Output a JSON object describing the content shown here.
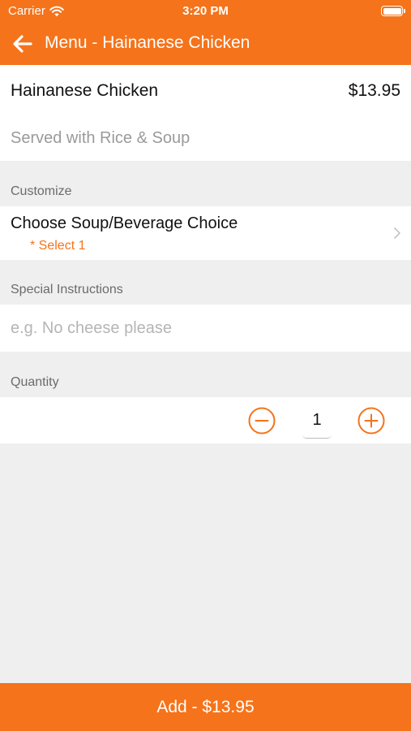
{
  "status_bar": {
    "carrier": "Carrier",
    "time": "3:20 PM",
    "wifi_icon": "wifi-icon",
    "battery_icon": "battery-icon",
    "battery_level": 1.0
  },
  "nav": {
    "back_icon": "arrow-left-icon",
    "title": "Menu - Hainanese Chicken"
  },
  "item": {
    "name": "Hainanese Chicken",
    "price": "$13.95",
    "description": "Served with Rice & Soup"
  },
  "sections": {
    "customize_label": "Customize",
    "instructions_label": "Special Instructions",
    "quantity_label": "Quantity"
  },
  "customize": {
    "option_title": "Choose Soup/Beverage Choice",
    "requirement": "* Select 1",
    "chevron_icon": "chevron-right-icon"
  },
  "instructions": {
    "value": "",
    "placeholder": "e.g. No cheese please"
  },
  "quantity": {
    "value": "1",
    "minus_icon": "minus-circle-icon",
    "plus_icon": "plus-circle-icon"
  },
  "add_button": {
    "label": "Add - $13.95"
  },
  "colors": {
    "accent": "#f5731a",
    "background": "#efefef",
    "secondary_text": "#9a9a9a"
  }
}
